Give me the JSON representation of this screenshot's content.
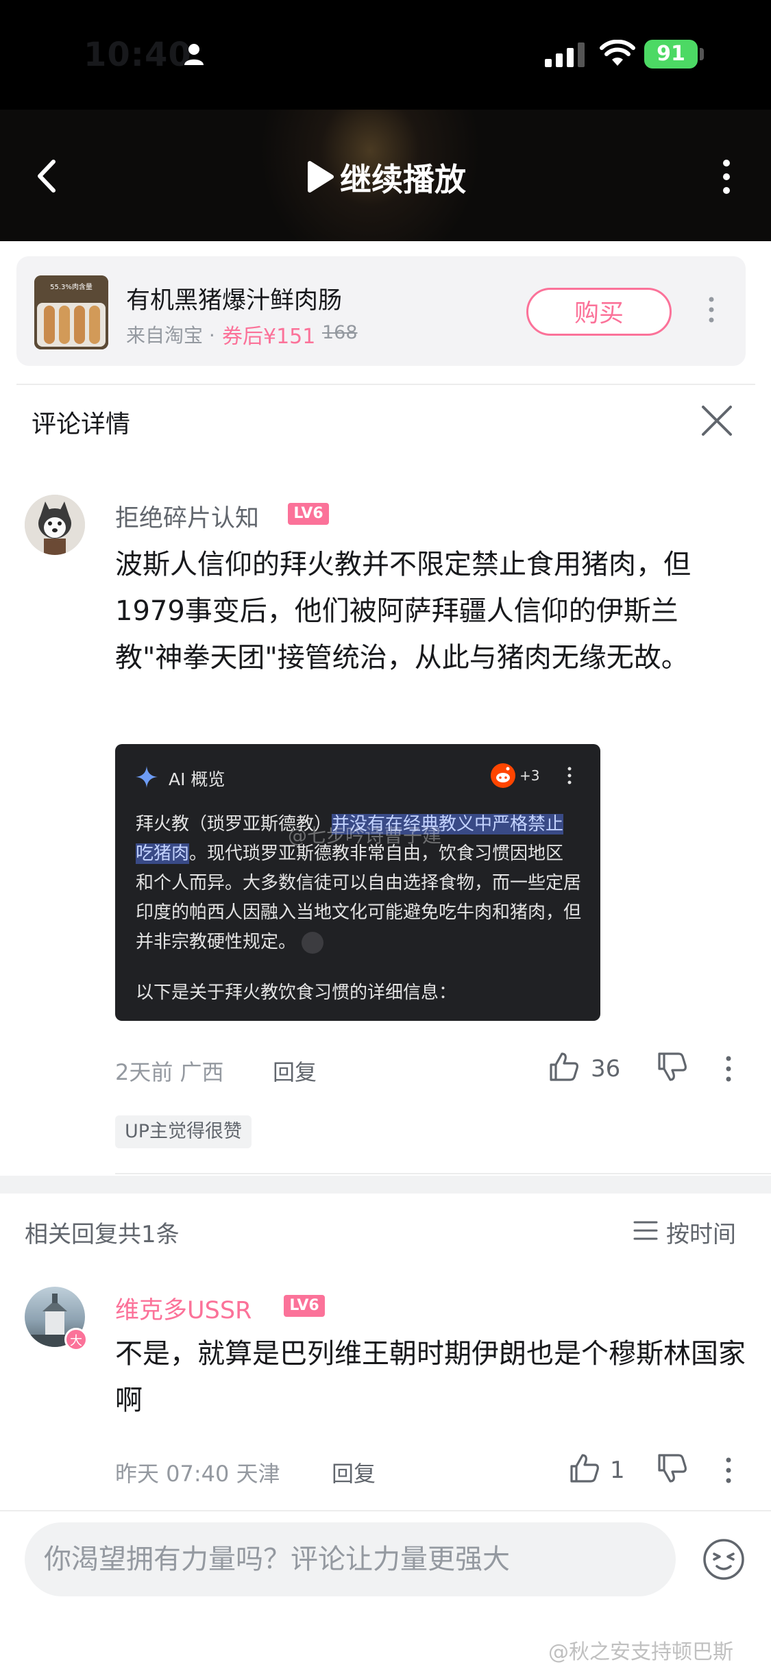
{
  "status_bar": {
    "time": "10:40",
    "battery": "91"
  },
  "header": {
    "title": "继续播放"
  },
  "product": {
    "thumb_text": "55.3%肉含量",
    "title": "有机黑猪爆汁鲜肉肠",
    "source": "来自淘宝 · ",
    "price": "券后¥151",
    "original_price": "168",
    "buy_label": "购买"
  },
  "detail": {
    "title": "评论详情"
  },
  "main_comment": {
    "username": "拒绝碎片认知",
    "level": "LV6",
    "text": "波斯人信仰的拜火教并不限定禁止食用猪肉，但1979事变后，他们被阿萨拜疆人信仰的伊斯兰教\"神拳天团\"接管统治，从此与猪肉无缘无故。",
    "ai_image": {
      "label": "AI 概览",
      "count": "+3",
      "text_before": "拜火教（琐罗亚斯德教）",
      "text_highlight": "并没有在经典教义中严格禁止吃猪肉",
      "text_after": "。现代琐罗亚斯德教非常自由，饮食习惯因地区和个人而异。大多数信徒可以自由选择食物，而一些定居印度的帕西人因融入当地文化可能避免吃牛肉和猪肉，但并非宗教硬性规定。",
      "more_text": "以下是关于拜火教饮食习惯的详细信息：",
      "watermark": "@七步吟诗曹子建"
    },
    "time_location": "2天前 广西",
    "reply_label": "回复",
    "likes": "36",
    "up_tag": "UP主觉得很赞"
  },
  "related": {
    "count_label": "相关回复共1条",
    "sort_label": "按时间"
  },
  "reply_comment": {
    "username": "维克多USSR",
    "level": "LV6",
    "avatar_badge": "大",
    "text": "不是，就算是巴列维王朝时期伊朗也是个穆斯林国家啊",
    "time_location": "昨天 07:40 天津",
    "reply_label": "回复",
    "likes": "1"
  },
  "input": {
    "placeholder": "你渴望拥有力量吗？评论让力量更强大"
  },
  "watermark": "@秋之安支持顿巴斯",
  "colors": {
    "accent": "#fb7299",
    "text_secondary": "#61666d",
    "text_muted": "#9499a0"
  }
}
